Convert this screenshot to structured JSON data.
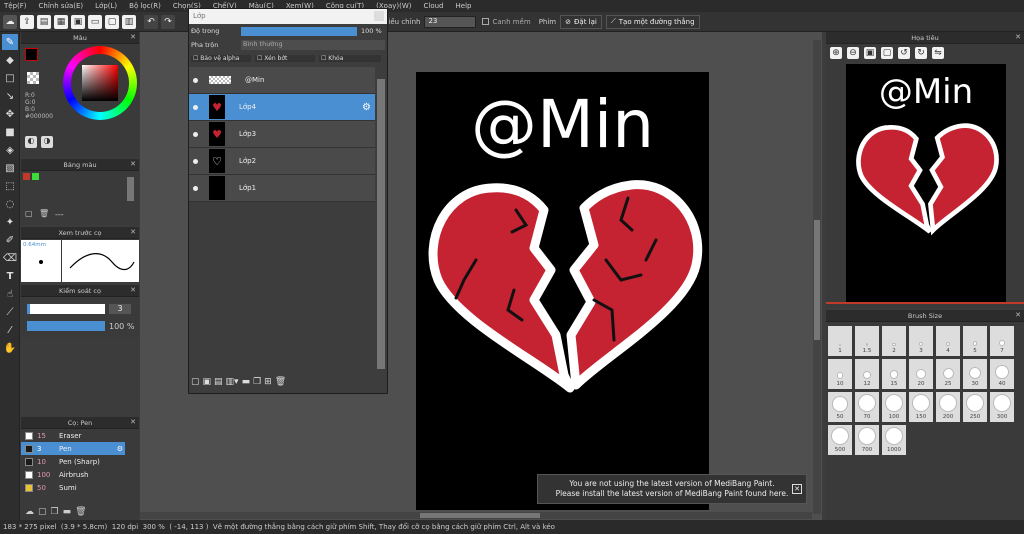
{
  "menu": [
    "Tệp(F)",
    "Chỉnh sửa(E)",
    "Lớp(L)",
    "Bộ lọc(R)",
    "Chọn(S)",
    "Chế(V)",
    "Màu(C)",
    "Xem(W)",
    "Công cụ(T)",
    "(Xoay)(W)",
    "Cloud",
    "Help"
  ],
  "toolbar": {
    "opacity_label": "Điều chỉnh",
    "opacity_value": "23",
    "antialias_label": "Canh mềm",
    "pen_label": "Phím",
    "reset_label": "Đặt lại",
    "new_ruler_label": "Tạo một đường thẳng"
  },
  "color_panel": {
    "title": "Màu",
    "values": [
      "R:0",
      "G:0",
      "B:0"
    ],
    "hex": "#000000"
  },
  "palette_panel": {
    "title": "Bảng màu",
    "dash": "---"
  },
  "brush_preview": {
    "title": "Xem trước cọ",
    "size": "0.64mm"
  },
  "brush_control": {
    "title": "Kiểm soát cọ",
    "size_value": "3",
    "opacity_value": "100 %"
  },
  "brush_list": {
    "title": "Cọ: Pen",
    "items": [
      {
        "size": "15",
        "name": "Eraser",
        "color": "#ffffff"
      },
      {
        "size": "3",
        "name": "Pen",
        "color": "#1a1a1a",
        "selected": true
      },
      {
        "size": "10",
        "name": "Pen (Sharp)",
        "color": "#1a1a1a"
      },
      {
        "size": "100",
        "name": "Airbrush",
        "color": "#ffffff"
      },
      {
        "size": "50",
        "name": "Sumi",
        "color": "#e8c13a"
      }
    ]
  },
  "layers_panel": {
    "title": "Lớp",
    "opacity_label": "Độ trong",
    "opacity_value": "100 %",
    "blend_label": "Pha trộn",
    "blend_value": "Bình thường",
    "protect_alpha": "Bảo vệ alpha",
    "clipping": "Xén bớt",
    "lock": "Khóa",
    "layers": [
      {
        "name": "@Min",
        "type": "text"
      },
      {
        "name": "Lớp4",
        "type": "heart",
        "selected": true
      },
      {
        "name": "Lớp3",
        "type": "heart"
      },
      {
        "name": "Lớp2",
        "type": "outline"
      },
      {
        "name": "Lớp1",
        "type": "black"
      }
    ]
  },
  "canvas": {
    "text": "@Min"
  },
  "navigator": {
    "title": "Họa tiêu",
    "text": "@Min"
  },
  "brush_size": {
    "title": "Brush Size",
    "sizes": [
      "1",
      "1.5",
      "2",
      "3",
      "4",
      "5",
      "7",
      "10",
      "12",
      "15",
      "20",
      "25",
      "30",
      "40",
      "50",
      "70",
      "100",
      "150",
      "200",
      "250",
      "300",
      "500",
      "700",
      "1000"
    ]
  },
  "notice": {
    "line1": "You are not using the latest version of MediBang Paint.",
    "line2": "Please install the latest version of MediBang Paint found here."
  },
  "status": {
    "size": "183 * 275 pixel",
    "physical": "(3.9 * 5.8cm)",
    "dpi": "120 dpi",
    "zoom": "300 %",
    "coords": "( -14, 113 )",
    "hint": "Vẽ một đường thẳng bằng cách giữ phím Shift, Thay đổi cỡ cọ bằng cách giữ phím Ctrl, Alt và kéo"
  },
  "colors": {
    "accent": "#4a8fd1",
    "heart": "#c52232",
    "primary": "#000000"
  }
}
